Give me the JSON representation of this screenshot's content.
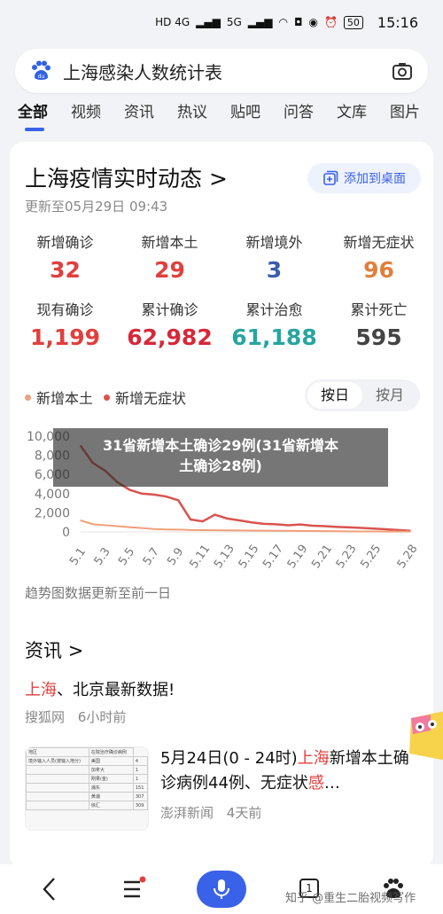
{
  "status_bar": {
    "network": "HD 4G",
    "network2": "5G",
    "battery": "50",
    "time": "15:16"
  },
  "search": {
    "query": "上海感染人数统计表",
    "logo_icon": "baidu-paw-icon",
    "camera_icon": "camera-icon"
  },
  "tabs": [
    "全部",
    "视频",
    "资讯",
    "热议",
    "贴吧",
    "问答",
    "文库",
    "图片"
  ],
  "card": {
    "title": "上海疫情实时动态",
    "title_chevron": ">",
    "add_button": "添加到桌面",
    "updated": "更新至05月29日 09:43",
    "stats_row1": [
      {
        "label": "新增确诊",
        "value": "32",
        "color": "#e0403d"
      },
      {
        "label": "新增本土",
        "value": "29",
        "color": "#e0403d"
      },
      {
        "label": "新增境外",
        "value": "3",
        "color": "#3a5cb0"
      },
      {
        "label": "新增无症状",
        "value": "96",
        "color": "#e07f3d"
      }
    ],
    "stats_row2": [
      {
        "label": "现有确诊",
        "value": "1,199",
        "color": "#e0403d"
      },
      {
        "label": "累计确诊",
        "value": "62,982",
        "color": "#d6283a"
      },
      {
        "label": "累计治愈",
        "value": "61,188",
        "color": "#27a5a0"
      },
      {
        "label": "累计死亡",
        "value": "595",
        "color": "#444444"
      }
    ],
    "legend": [
      {
        "name": "新增本土",
        "color": "#f0a07a"
      },
      {
        "name": "新增无症状",
        "color": "#d9534f"
      }
    ],
    "toggle": {
      "daily": "按日",
      "monthly": "按月"
    },
    "overlay_text_line1": "31省新增本土确诊29例(31省新增本",
    "overlay_text_line2": "土确诊28例)",
    "chart_note": "趋势图数据更新至前一日"
  },
  "chart_data": {
    "type": "line",
    "x": [
      "5.1",
      "5.2",
      "5.3",
      "5.4",
      "5.5",
      "5.6",
      "5.7",
      "5.8",
      "5.9",
      "5.10",
      "5.11",
      "5.12",
      "5.13",
      "5.14",
      "5.15",
      "5.16",
      "5.17",
      "5.18",
      "5.19",
      "5.20",
      "5.21",
      "5.22",
      "5.23",
      "5.24",
      "5.25",
      "5.26",
      "5.27",
      "5.28"
    ],
    "tick_labels": [
      "5.1",
      "5.3",
      "5.5",
      "5.7",
      "5.9",
      "5.11",
      "5.13",
      "5.15",
      "5.17",
      "5.19",
      "5.21",
      "5.23",
      "5.25",
      "5.28"
    ],
    "ylim": [
      0,
      10000
    ],
    "yticks": [
      "10,000",
      "8,000",
      "6,000",
      "4,000",
      "2,000",
      "0"
    ],
    "series": [
      {
        "name": "新增无症状",
        "color": "#d9534f",
        "values": [
          9000,
          7200,
          6400,
          5200,
          4400,
          4000,
          3900,
          3700,
          3300,
          1300,
          1100,
          1800,
          1400,
          1200,
          1000,
          850,
          800,
          700,
          780,
          650,
          600,
          520,
          480,
          420,
          350,
          280,
          200,
          120
        ]
      },
      {
        "name": "新增本土",
        "color": "#f0a07a",
        "values": [
          1200,
          800,
          700,
          600,
          500,
          400,
          300,
          260,
          240,
          200,
          180,
          170,
          160,
          150,
          140,
          130,
          120,
          110,
          100,
          90,
          80,
          70,
          60,
          50,
          45,
          40,
          35,
          29
        ]
      }
    ]
  },
  "news": {
    "header": "资讯",
    "header_chevron": ">",
    "item1_title_red": "上海",
    "item1_title_rest": "、北京最新数据!",
    "item1_source": "搜狐网",
    "item1_time": "6小时前",
    "item2_title_a": "5月24日(0 - 24时)",
    "item2_title_red": "上海",
    "item2_title_b": "新增本土确诊病例44例、无症状",
    "item2_title_red2": "感",
    "item2_title_c": "…",
    "item2_source": "澎湃新闻",
    "item2_time": "4天前",
    "thumb_rows": [
      [
        "地区",
        "在院治疗确诊病例"
      ],
      [
        "境外输入人员(按输入地分)",
        "美国",
        "4"
      ],
      [
        "",
        "加拿大",
        "1"
      ],
      [
        "",
        "刚果(金)",
        "1"
      ],
      [
        "",
        "浦东",
        "151"
      ],
      [
        "",
        "黄浦",
        "307"
      ],
      [
        "",
        "徐汇",
        "309"
      ]
    ]
  },
  "bottom": {
    "tab_count": "1",
    "watermark": "知乎 @重生二胎视频写作"
  }
}
